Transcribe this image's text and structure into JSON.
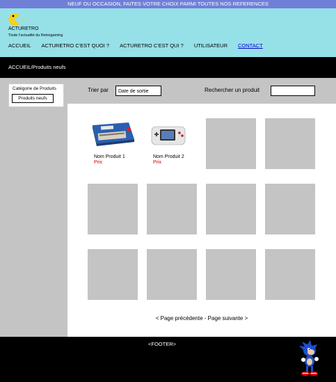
{
  "topbar": {
    "text": "NEUF OU OCCASION, FAITES VOTRE CHOIX PARMI TOUTES NOS REFERENCES"
  },
  "header": {
    "brand": "ACTURETRO",
    "tagline": "Toute l'actualité du Retrogaming",
    "logo_icon": "pacman-icon"
  },
  "nav": {
    "items": [
      {
        "label": "ACCUEIL"
      },
      {
        "label": "ACTURETRO C'EST QUOI ?"
      },
      {
        "label": "ACTURETRO C'EST QUI ?"
      },
      {
        "label": "UTILISATEUR"
      },
      {
        "label": "CONTACT"
      }
    ]
  },
  "breadcrumb": {
    "text": "ACCUEIL/Produits neufs"
  },
  "sidebar": {
    "category_title": "Catégorie de Produits",
    "category_value": "Produits neufs"
  },
  "toolbar": {
    "sort_label": "Trier par",
    "sort_value": "Date de sortie",
    "search_label": "Rechercher un produit",
    "search_value": ""
  },
  "products": [
    {
      "name": "Nom Produit 1",
      "price": "Prix",
      "image_icon": "c64-console-box-icon"
    },
    {
      "name": "Nom Produit 2",
      "price": "Prix",
      "image_icon": "handheld-console-icon"
    }
  ],
  "pager": {
    "prev": "< Page précédente",
    "separator": " - ",
    "next": "Page suivante >"
  },
  "footer": {
    "label": "<FOOTER>",
    "mascot_icon": "sonic-mascot-icon"
  },
  "colors": {
    "topbar": "#6f7fd8",
    "header": "#96e0e8",
    "dark": "#000000",
    "panel": "#c4c4c4",
    "price": "#cc0000",
    "link": "#0000cc"
  }
}
